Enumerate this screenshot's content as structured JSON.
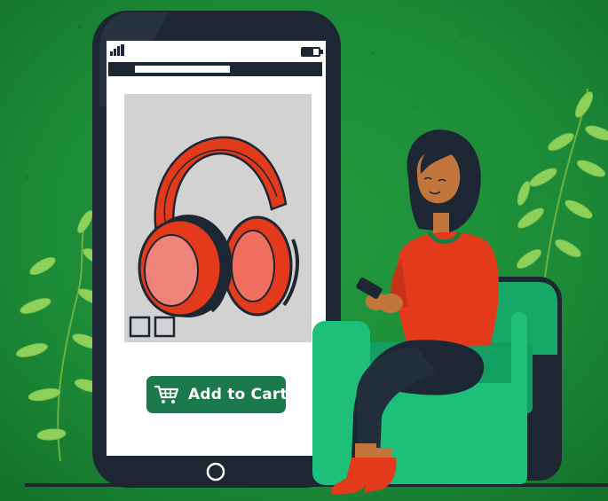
{
  "colors": {
    "background": "#1f8a3e",
    "accent_button": "#1a7a4c",
    "phone_frame": "#1d2733",
    "headphones": "#e23a1b",
    "chair": "#1dbf7a"
  },
  "phone": {
    "status_icons": [
      "signal-icon",
      "battery-icon"
    ],
    "product_image": "red-headphones",
    "thumbnails": [
      "thumbnail-1",
      "thumbnail-2"
    ],
    "add_to_cart_label": "Add to Cart",
    "cart_icon": "shopping-cart-icon",
    "home_button_icon": "home-button-icon"
  },
  "illustration": {
    "subject": "woman-sitting-in-armchair-using-phone"
  }
}
